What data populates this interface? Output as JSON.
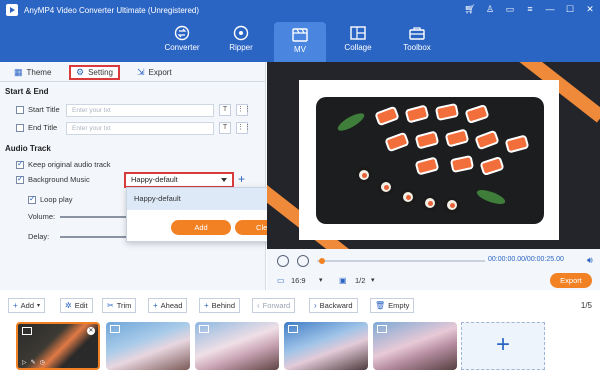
{
  "window": {
    "title": "AnyMP4 Video Converter Ultimate (Unregistered)",
    "controls": [
      "cart-icon",
      "user-icon",
      "chat-icon",
      "menu-icon",
      "minimize-icon",
      "maximize-icon",
      "close-icon"
    ]
  },
  "nav": {
    "items": [
      {
        "label": "Converter",
        "icon": "converter-icon"
      },
      {
        "label": "Ripper",
        "icon": "disc-icon"
      },
      {
        "label": "MV",
        "icon": "mv-icon",
        "active": true
      },
      {
        "label": "Collage",
        "icon": "collage-icon"
      },
      {
        "label": "Toolbox",
        "icon": "toolbox-icon"
      }
    ]
  },
  "panel": {
    "tabs": [
      {
        "label": "Theme",
        "icon": "grid-icon"
      },
      {
        "label": "Setting",
        "icon": "gear-icon",
        "active": true
      },
      {
        "label": "Export",
        "icon": "export-icon"
      }
    ],
    "start_end": {
      "heading": "Start & End",
      "start_title": {
        "label": "Start Title",
        "placeholder": "Enter your txt",
        "checked": false
      },
      "end_title": {
        "label": "End Title",
        "placeholder": "Enter your txt",
        "checked": false
      }
    },
    "audio": {
      "heading": "Audio Track",
      "keep_original": {
        "label": "Keep original audio track",
        "checked": true
      },
      "background_music": {
        "label": "Background Music",
        "checked": true,
        "value": "Happy-default"
      },
      "loop_play": {
        "label": "Loop play",
        "checked": true
      },
      "volume_label": "Volume:",
      "delay_label": "Delay:"
    }
  },
  "popup": {
    "selected": "Happy-default",
    "add_label": "Add",
    "clear_label": "Clear"
  },
  "player": {
    "time": "00:00:00.00/00:00:25.00",
    "aspect": "16:9",
    "quality": "1/2",
    "export_label": "Export"
  },
  "toolbar": {
    "add": "Add",
    "edit": "Edit",
    "trim": "Trim",
    "ahead": "Ahead",
    "behind": "Behind",
    "forward": "Forward",
    "backward": "Backward",
    "empty": "Empty",
    "page": "1/5"
  },
  "colors": {
    "brand_blue": "#2b65c4",
    "accent_orange": "#f28123",
    "highlight_red": "#d93a3a"
  }
}
